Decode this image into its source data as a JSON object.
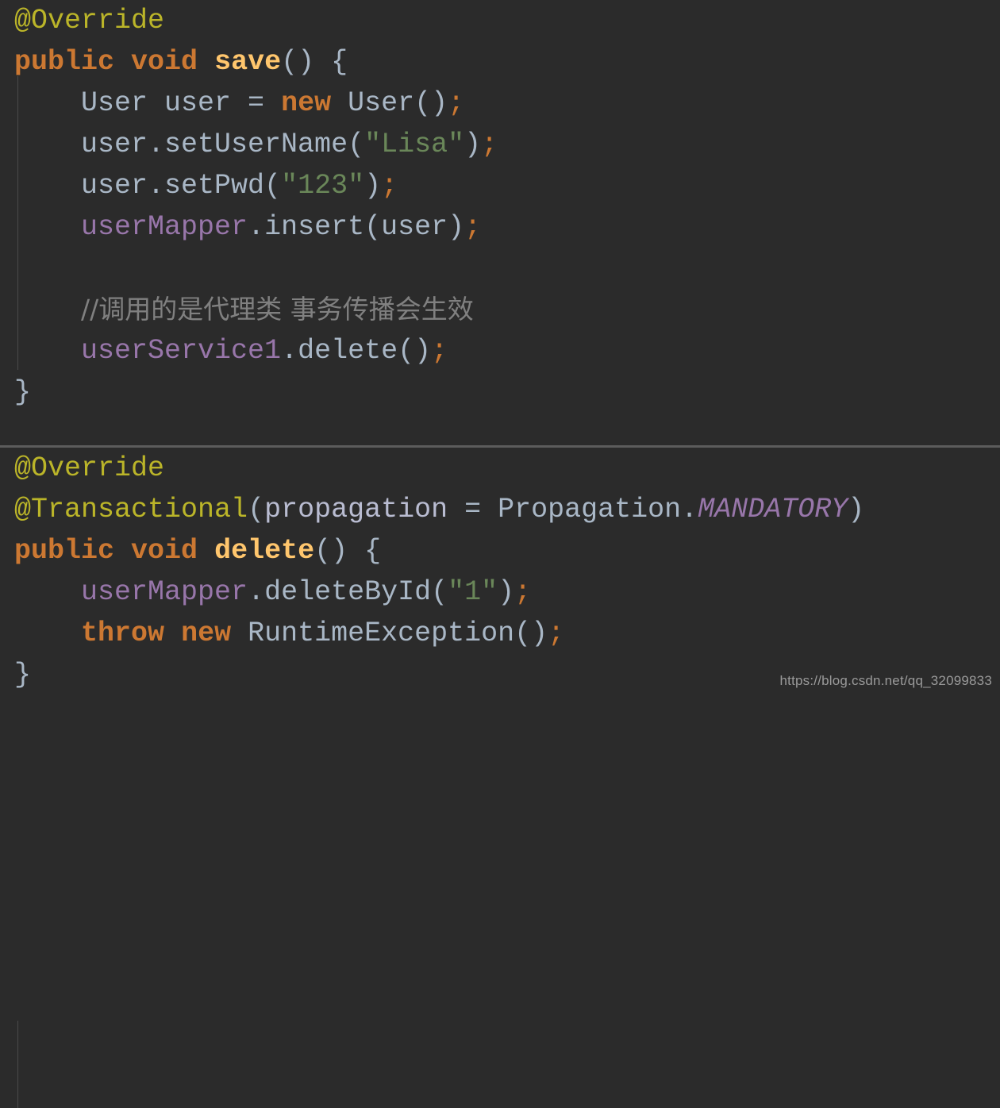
{
  "editor": {
    "theme_name": "darcula",
    "background_color": "#2b2b2b",
    "default_text_color": "#a9b7c6",
    "divider_color": "#5c5c5c",
    "indent_guide_color": "#4a4a4a",
    "language": "java"
  },
  "palette": {
    "annotation": "#bbb529",
    "keyword": "#cc7832",
    "method_name": "#ffc66d",
    "field": "#9876aa",
    "static_field": "#9876aa",
    "parameter": "#b9bcd1",
    "string": "#6a8759",
    "comment": "#808080",
    "plain": "#a9b7c6"
  },
  "blocks": [
    {
      "id": "save-method",
      "lines": [
        {
          "id": "save-l1",
          "tokens": [
            {
              "kind": "annotation",
              "text": "@Override"
            }
          ]
        },
        {
          "id": "save-l2",
          "tokens": [
            {
              "kind": "keyword",
              "text": "public"
            },
            {
              "kind": "plain",
              "text": " "
            },
            {
              "kind": "keyword",
              "text": "void"
            },
            {
              "kind": "plain",
              "text": " "
            },
            {
              "kind": "method",
              "text": "save"
            },
            {
              "kind": "punct",
              "text": "() {"
            }
          ]
        },
        {
          "id": "save-l3",
          "tokens": [
            {
              "kind": "plain",
              "text": "    User user = "
            },
            {
              "kind": "keyword",
              "text": "new"
            },
            {
              "kind": "plain",
              "text": " User()"
            },
            {
              "kind": "semi",
              "text": ";"
            }
          ]
        },
        {
          "id": "save-l4",
          "tokens": [
            {
              "kind": "plain",
              "text": "    user.setUserName("
            },
            {
              "kind": "string",
              "text": "\"Lisa\""
            },
            {
              "kind": "plain",
              "text": ")"
            },
            {
              "kind": "semi",
              "text": ";"
            }
          ]
        },
        {
          "id": "save-l5",
          "tokens": [
            {
              "kind": "plain",
              "text": "    user.setPwd("
            },
            {
              "kind": "string",
              "text": "\"123\""
            },
            {
              "kind": "plain",
              "text": ")"
            },
            {
              "kind": "semi",
              "text": ";"
            }
          ]
        },
        {
          "id": "save-l6",
          "tokens": [
            {
              "kind": "plain",
              "text": "    "
            },
            {
              "kind": "field",
              "text": "userMapper"
            },
            {
              "kind": "plain",
              "text": ".insert(user)"
            },
            {
              "kind": "semi",
              "text": ";"
            }
          ]
        },
        {
          "id": "save-l7",
          "tokens": []
        },
        {
          "id": "save-l8",
          "tokens": [
            {
              "kind": "plain",
              "text": "    "
            },
            {
              "kind": "comment-cjk",
              "text": "//调用的是代理类 事务传播会生效"
            }
          ]
        },
        {
          "id": "save-l9",
          "tokens": [
            {
              "kind": "plain",
              "text": "    "
            },
            {
              "kind": "field",
              "text": "userService1"
            },
            {
              "kind": "plain",
              "text": ".delete()"
            },
            {
              "kind": "semi",
              "text": ";"
            }
          ]
        },
        {
          "id": "save-l10",
          "tokens": [
            {
              "kind": "brace",
              "text": "}"
            }
          ]
        }
      ]
    },
    {
      "id": "delete-method",
      "lines": [
        {
          "id": "del-l1",
          "tokens": [
            {
              "kind": "annotation",
              "text": "@Override"
            }
          ]
        },
        {
          "id": "del-l2",
          "tokens": [
            {
              "kind": "annotation",
              "text": "@Transactional"
            },
            {
              "kind": "punct",
              "text": "("
            },
            {
              "kind": "parameter",
              "text": "propagation"
            },
            {
              "kind": "plain",
              "text": " = Propagation."
            },
            {
              "kind": "static",
              "text": "MANDATORY"
            },
            {
              "kind": "punct",
              "text": ")"
            }
          ]
        },
        {
          "id": "del-l3",
          "tokens": [
            {
              "kind": "keyword",
              "text": "public"
            },
            {
              "kind": "plain",
              "text": " "
            },
            {
              "kind": "keyword",
              "text": "void"
            },
            {
              "kind": "plain",
              "text": " "
            },
            {
              "kind": "method",
              "text": "delete"
            },
            {
              "kind": "punct",
              "text": "() {"
            }
          ]
        },
        {
          "id": "del-l4",
          "tokens": [
            {
              "kind": "plain",
              "text": "    "
            },
            {
              "kind": "field",
              "text": "userMapper"
            },
            {
              "kind": "plain",
              "text": ".deleteById("
            },
            {
              "kind": "string",
              "text": "\"1\""
            },
            {
              "kind": "plain",
              "text": ")"
            },
            {
              "kind": "semi",
              "text": ";"
            }
          ]
        },
        {
          "id": "del-l5",
          "tokens": [
            {
              "kind": "plain",
              "text": "    "
            },
            {
              "kind": "keyword",
              "text": "throw"
            },
            {
              "kind": "plain",
              "text": " "
            },
            {
              "kind": "keyword",
              "text": "new"
            },
            {
              "kind": "plain",
              "text": " RuntimeException()"
            },
            {
              "kind": "semi",
              "text": ";"
            }
          ]
        },
        {
          "id": "del-l6",
          "tokens": [
            {
              "kind": "brace",
              "text": "}"
            }
          ]
        }
      ]
    }
  ],
  "watermark": {
    "text": "https://blog.csdn.net/qq_32099833"
  }
}
